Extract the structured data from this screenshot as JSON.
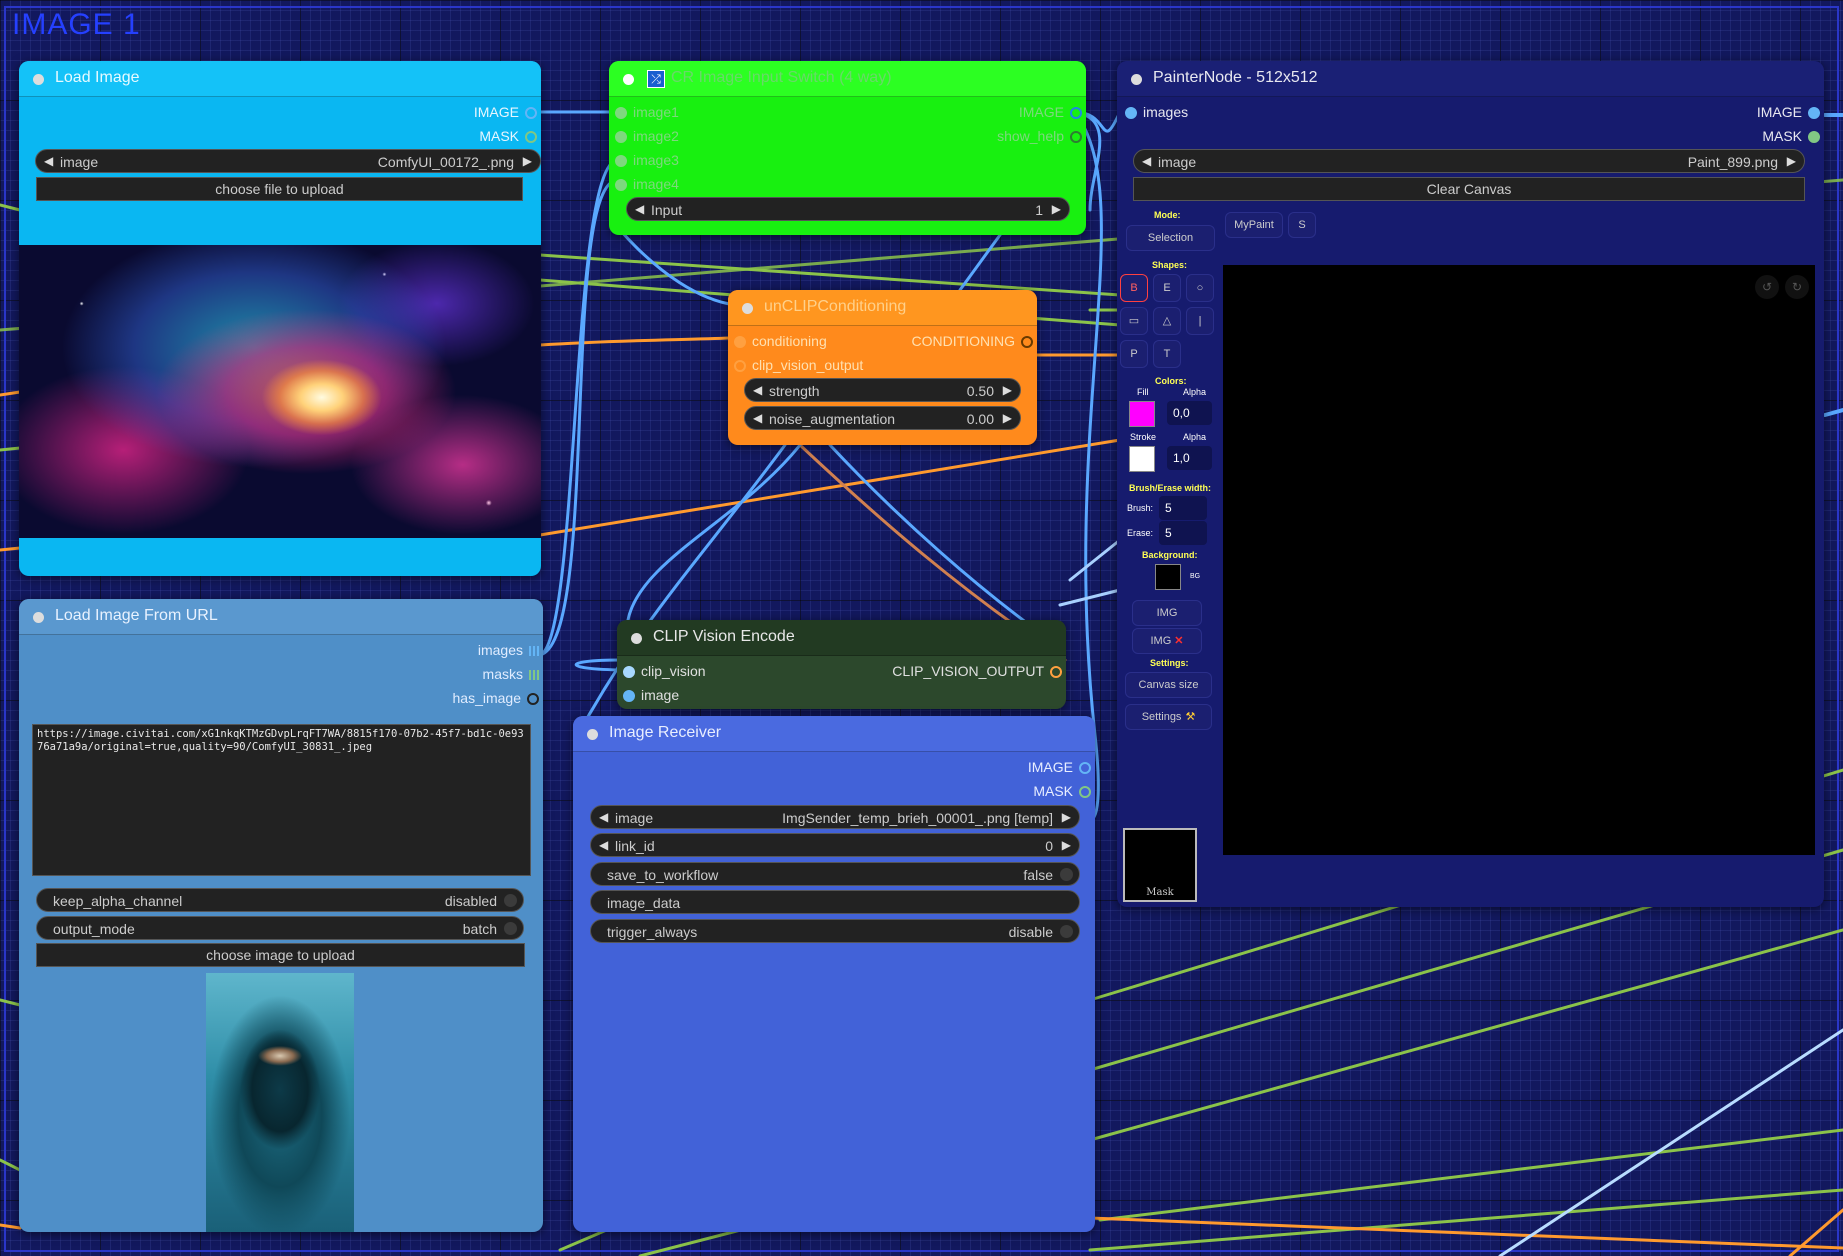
{
  "group": {
    "title": "IMAGE 1"
  },
  "load_image": {
    "title": "Load Image",
    "outputs": [
      "IMAGE",
      "MASK"
    ],
    "image_widget": {
      "label": "image",
      "value": "ComfyUI_00172_.png"
    },
    "upload_button": "choose file to upload",
    "preview": "galaxy nebula artwork"
  },
  "switch_node": {
    "title": "CR Image Input Switch (4 way)",
    "icon": "shuffle-icon",
    "inputs": [
      "image1",
      "image2",
      "image3",
      "image4"
    ],
    "outputs": [
      "IMAGE",
      "show_help"
    ],
    "input_widget": {
      "label": "Input",
      "value": "1"
    }
  },
  "unclip": {
    "title": "unCLIPConditioning",
    "inputs": [
      "conditioning",
      "clip_vision_output"
    ],
    "outputs": [
      "CONDITIONING"
    ],
    "strength": {
      "label": "strength",
      "value": "0.50"
    },
    "noise": {
      "label": "noise_augmentation",
      "value": "0.00"
    }
  },
  "clip_vision": {
    "title": "CLIP Vision Encode",
    "inputs": [
      "clip_vision",
      "image"
    ],
    "outputs": [
      "CLIP_VISION_OUTPUT"
    ]
  },
  "url_node": {
    "title": "Load Image From URL",
    "outputs": [
      "images",
      "masks",
      "has_image"
    ],
    "url_text": "https://image.civitai.com/xG1nkqKTMzGDvpLrqFT7WA/8815f170-07b2-45f7-bd1c-0e9376a71a9a/original=true,quality=90/ComfyUI_30831_.jpeg",
    "keep_alpha": {
      "label": "keep_alpha_channel",
      "value": "disabled"
    },
    "output_mode": {
      "label": "output_mode",
      "value": "batch"
    },
    "upload_button": "choose image to upload",
    "preview": "veiled figure portrait"
  },
  "receiver": {
    "title": "Image Receiver",
    "outputs": [
      "IMAGE",
      "MASK"
    ],
    "image": {
      "label": "image",
      "value": "ImgSender_temp_brieh_00001_.png [temp]"
    },
    "link_id": {
      "label": "link_id",
      "value": "0"
    },
    "save": {
      "label": "save_to_workflow",
      "value": "false"
    },
    "image_data": {
      "label": "image_data"
    },
    "trigger": {
      "label": "trigger_always",
      "value": "disable"
    }
  },
  "painter": {
    "title": "PainterNode - 512x512",
    "inputs": [
      "images"
    ],
    "outputs": [
      "IMAGE",
      "MASK"
    ],
    "image": {
      "label": "image",
      "value": "Paint_899.png"
    },
    "clear_button": "Clear Canvas",
    "mode_label": "Mode:",
    "mode_value": "Selection",
    "mypaint": "MyPaint",
    "s_button": "S",
    "shapes_label": "Shapes:",
    "shapes": [
      "B",
      "E",
      "○",
      "▭",
      "△",
      "|",
      "P",
      "T"
    ],
    "colors_label": "Colors:",
    "fill_label": "Fill",
    "alpha_label": "Alpha",
    "fill_alpha": "0,0",
    "stroke_label": "Stroke",
    "stroke_alpha": "1,0",
    "brush_erase_label": "Brush/Erase width:",
    "brush_label": "Brush:",
    "brush_value": "5",
    "erase_label": "Erase:",
    "erase_value": "5",
    "background_label": "Background:",
    "bg_label": "BG",
    "img_button": "IMG",
    "img_x_button": "IMG",
    "settings_label": "Settings:",
    "canvas_size_button": "Canvas size",
    "settings_button": "Settings",
    "mask_label": "Mask"
  },
  "colors": {
    "load_image": "#0ab7f2",
    "switch": "#18f010",
    "unclip": "#ff8a1c",
    "clip_vision": "#2c482c",
    "url_node": "#4f8fc8",
    "receiver": "#4262d8",
    "painter": "#161b6e"
  }
}
